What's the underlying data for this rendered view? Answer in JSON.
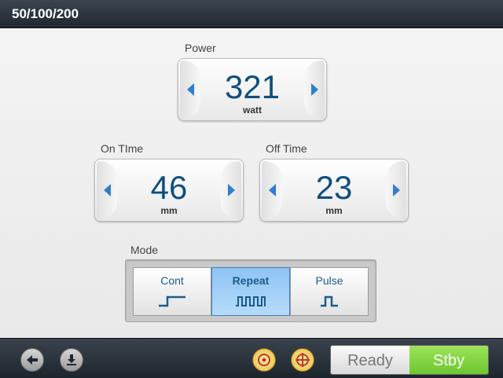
{
  "title": "50/100/200",
  "power": {
    "label": "Power",
    "value": "321",
    "unit": "watt"
  },
  "on_time": {
    "label": "On TIme",
    "value": "46",
    "unit": "mm"
  },
  "off_time": {
    "label": "Off Time",
    "value": "23",
    "unit": "mm"
  },
  "mode": {
    "label": "Mode",
    "options": [
      {
        "label": "Cont",
        "icon": "continuous-wave-icon",
        "selected": false
      },
      {
        "label": "Repeat",
        "icon": "repeat-wave-icon",
        "selected": true
      },
      {
        "label": "Pulse",
        "icon": "pulse-wave-icon",
        "selected": false
      }
    ]
  },
  "status": {
    "ready_label": "Ready",
    "stby_label": "Stby",
    "active": "Stby"
  },
  "colors": {
    "accent": "#2f7ecf",
    "value_text": "#0f4f7f",
    "stby": "#7acd3a"
  }
}
